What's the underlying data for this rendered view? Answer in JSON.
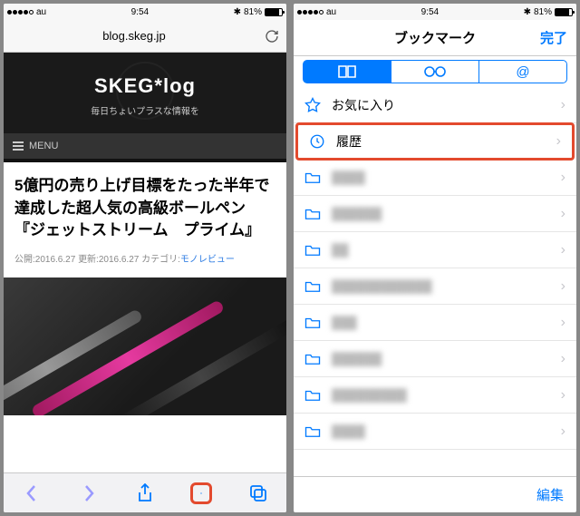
{
  "status": {
    "carrier": "au",
    "time": "9:54",
    "battery_pct": "81%"
  },
  "left": {
    "url": "blog.skeg.jp",
    "site_title": "SKEG*log",
    "site_tag": "毎日ちょいプラスな情報を",
    "menu_label": "MENU",
    "article_title": "5億円の売り上げ目標をたった半年で達成した超人気の高級ボールペン『ジェットストリーム　プライム』",
    "meta_pub_label": "公開:",
    "meta_pub": "2016.6.27",
    "meta_upd_label": "更新:",
    "meta_upd": "2016.6.27",
    "meta_cat_label": "カテゴリ:",
    "meta_cat": "モノレビュー"
  },
  "right": {
    "title": "ブックマーク",
    "done": "完了",
    "tabs": [
      "bookmarks",
      "reading-list",
      "shared"
    ],
    "favorites": "お気に入り",
    "history": "履歴",
    "edit": "編集"
  },
  "colors": {
    "accent": "#007aff",
    "highlight": "#e34a2e"
  }
}
